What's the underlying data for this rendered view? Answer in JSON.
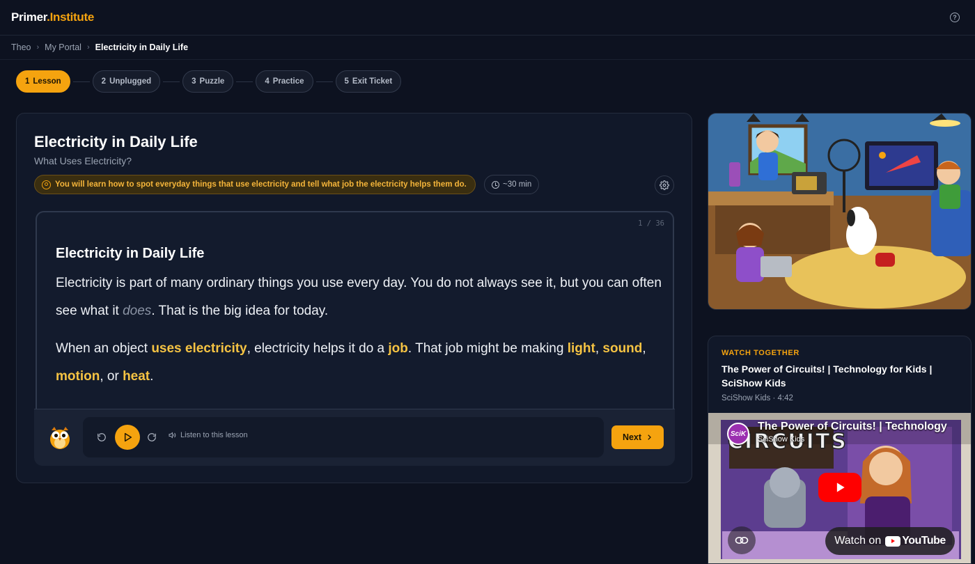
{
  "brand": {
    "name_part1": "Primer",
    "name_part2": ".Institute"
  },
  "breadcrumb": [
    "Theo",
    "My Portal",
    "Electricity in Daily Life"
  ],
  "steps": [
    {
      "num": "1",
      "label": "Lesson"
    },
    {
      "num": "2",
      "label": "Unplugged"
    },
    {
      "num": "3",
      "label": "Puzzle"
    },
    {
      "num": "4",
      "label": "Practice"
    },
    {
      "num": "5",
      "label": "Exit Ticket"
    }
  ],
  "active_step": 0,
  "lesson": {
    "title": "Electricity in Daily Life",
    "subtitle": "What Uses Electricity?",
    "objective": "You will learn how to spot everyday things that use electricity and tell what job the electricity helps them do.",
    "duration": "~30 min"
  },
  "reader": {
    "counter": "1 / 36",
    "title": "Electricity in Daily Life",
    "p1_a": "Electricity is part of many ordinary things you use every day. You do not always see it, but you can often see what it ",
    "p1_em": "does",
    "p1_b": ". That is the big idea for today.",
    "p2_a": "When an object ",
    "p2_hl1": "uses electricity",
    "p2_b": ", electricity helps it do a ",
    "p2_hl2": "job",
    "p2_c": ". That job might be making ",
    "p2_hl3": "light",
    "p2_d": ", ",
    "p2_hl4": "sound",
    "p2_e": ", ",
    "p2_hl5": "motion",
    "p2_f": ", or ",
    "p2_hl6": "heat",
    "p2_g": "."
  },
  "player": {
    "listen_label": "Listen to this lesson",
    "next_label": "Next"
  },
  "video": {
    "label": "WATCH TOGETHER",
    "title": "The Power of Circuits! | Technology for Kids | SciShow Kids",
    "meta": "SciShow Kids · 4:42",
    "embed_title": "The Power of Circuits! | Technology",
    "embed_channel": "SciShow Kids",
    "channel_badge": "SciK",
    "sign_text": "CIRCUITS",
    "watch_on": "Watch on",
    "yt_brand": "YouTube"
  },
  "colors": {
    "accent": "#f5a30f",
    "background": "#0d1220",
    "highlight": "#f5c343"
  }
}
